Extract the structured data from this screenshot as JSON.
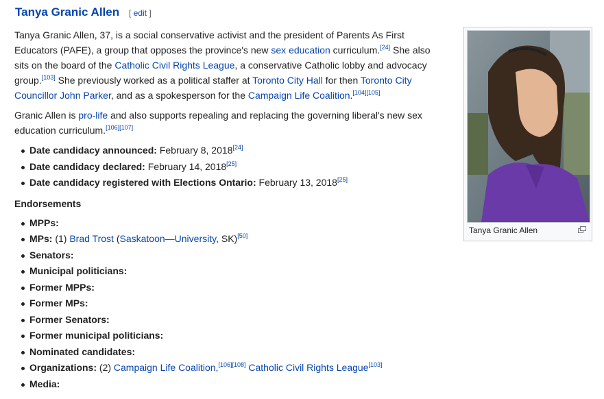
{
  "heading": {
    "title": "Tanya Granic Allen",
    "edit_open": "[ ",
    "edit_label": "edit",
    "edit_close": " ]"
  },
  "para1": [
    {
      "t": "Tanya Granic Allen, 37, is a social conservative activist and the president of Parents As First Educators (PAFE), a group that opposes the province's new "
    },
    {
      "t": "sex education",
      "link": true
    },
    {
      "t": " curriculum."
    },
    {
      "t": "[24]",
      "sup": true
    },
    {
      "t": " She also sits on the board of the "
    },
    {
      "t": "Catholic Civil Rights League",
      "link": true
    },
    {
      "t": ", a conservative Catholic lobby and advocacy group."
    },
    {
      "t": "[103]",
      "sup": true
    },
    {
      "t": " She previously worked as a political staffer at "
    },
    {
      "t": "Toronto City Hall",
      "link": true
    },
    {
      "t": " for then "
    },
    {
      "t": "Toronto City Councillor John Parker",
      "link": true
    },
    {
      "t": ", and as a spokesperson for the "
    },
    {
      "t": "Campaign Life Coalition",
      "link": true
    },
    {
      "t": "."
    },
    {
      "t": "[104][105]",
      "sup": true
    }
  ],
  "para2": [
    {
      "t": "Granic Allen is "
    },
    {
      "t": "pro-life",
      "link": true
    },
    {
      "t": " and also supports repealing and replacing the governing liberal's new sex education curriculum."
    },
    {
      "t": "[106][107]",
      "sup": true
    }
  ],
  "facts": [
    [
      {
        "t": "Date candidacy announced:",
        "bold": true
      },
      {
        "t": " February 8, 2018"
      },
      {
        "t": "[24]",
        "sup": true
      }
    ],
    [
      {
        "t": "Date candidacy declared:",
        "bold": true
      },
      {
        "t": " February 14, 2018"
      },
      {
        "t": "[25]",
        "sup": true
      }
    ],
    [
      {
        "t": "Date candidacy registered with Elections Ontario:",
        "bold": true
      },
      {
        "t": " February 13, 2018"
      },
      {
        "t": "[25]",
        "sup": true
      }
    ]
  ],
  "endorsements_heading": "Endorsements",
  "endorsements": [
    [
      {
        "t": "MPPs:",
        "bold": true
      }
    ],
    [
      {
        "t": "MPs:",
        "bold": true
      },
      {
        "t": " (1) "
      },
      {
        "t": "Brad Trost",
        "link": true
      },
      {
        "t": " ("
      },
      {
        "t": "Saskatoon—University",
        "link": true
      },
      {
        "t": ", SK)"
      },
      {
        "t": "[50]",
        "sup": true
      }
    ],
    [
      {
        "t": "Senators:",
        "bold": true
      }
    ],
    [
      {
        "t": "Municipal politicians:",
        "bold": true
      }
    ],
    [
      {
        "t": "Former MPPs:",
        "bold": true
      }
    ],
    [
      {
        "t": "Former MPs:",
        "bold": true
      }
    ],
    [
      {
        "t": "Former Senators:",
        "bold": true
      }
    ],
    [
      {
        "t": "Former municipal politicians:",
        "bold": true
      }
    ],
    [
      {
        "t": "Nominated candidates:",
        "bold": true
      }
    ],
    [
      {
        "t": "Organizations:",
        "bold": true
      },
      {
        "t": " (2) "
      },
      {
        "t": "Campaign Life Coalition",
        "link": true
      },
      {
        "t": ","
      },
      {
        "t": "[106][108]",
        "sup": true
      },
      {
        "t": " "
      },
      {
        "t": "Catholic Civil Rights League",
        "link": true
      },
      {
        "t": "[103]",
        "sup": true
      }
    ],
    [
      {
        "t": "Media:",
        "bold": true
      }
    ]
  ],
  "thumbnail": {
    "caption": "Tanya Granic Allen",
    "enlarge_icon": "magnify-clip-icon"
  }
}
